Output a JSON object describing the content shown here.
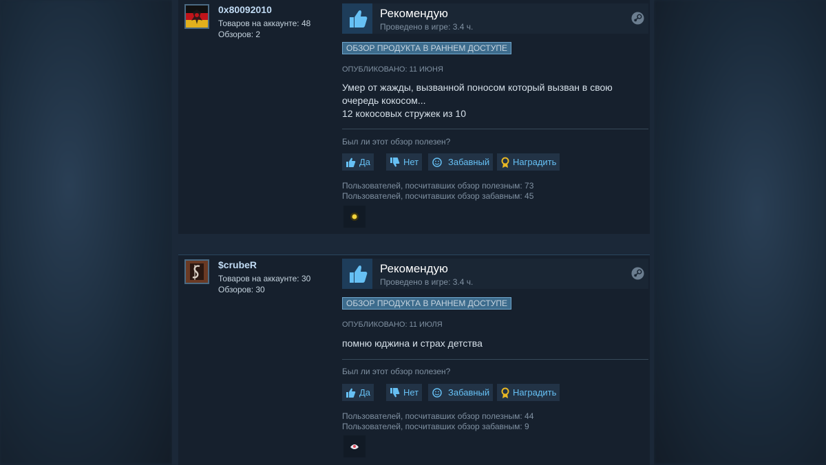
{
  "reviews": [
    {
      "author": {
        "name": "0x80092010",
        "products": "Товаров на аккаунте: 48",
        "reviews": "Обзоров: 2"
      },
      "vote": {
        "title": "Рекомендую",
        "hours": "Проведено в игре: 3.4 ч."
      },
      "badge": "ОБЗОР ПРОДУКТА В РАННЕМ ДОСТУПЕ",
      "posted": "ОПУБЛИКОВАНО: 11 ИЮНЯ",
      "content": [
        "Умер от жажды, вызванной поносом который вызван в свою",
        "очередь кокосом...",
        "12 кокосовых стружек из 10"
      ],
      "helpful_question": "Был ли этот обзор полезен?",
      "buttons": {
        "yes": "Да",
        "no": "Нет",
        "funny": "Забавный",
        "award": "Наградить"
      },
      "stats": {
        "helpful": "Пользователей, посчитавших обзор полезным: 73",
        "funny": "Пользователей, посчитавших обзор забавным: 45"
      }
    },
    {
      "author": {
        "name": "$crubeR",
        "products": "Товаров на аккаунте: 30",
        "reviews": "Обзоров: 30"
      },
      "vote": {
        "title": "Рекомендую",
        "hours": "Проведено в игре: 3.4 ч."
      },
      "badge": "ОБЗОР ПРОДУКТА В РАННЕМ ДОСТУПЕ",
      "posted": "ОПУБЛИКОВАНО: 11 ИЮЛЯ",
      "content": [
        "помню юджина и страх детства"
      ],
      "helpful_question": "Был ли этот обзор полезен?",
      "buttons": {
        "yes": "Да",
        "no": "Нет",
        "funny": "Забавный",
        "award": "Наградить"
      },
      "stats": {
        "helpful": "Пользователей, посчитавших обзор полезным: 44",
        "funny": "Пользователей, посчитавших обзор забавным: 9"
      }
    }
  ],
  "icons": {
    "thumbs_up_large": "thumbs-up-icon",
    "steam": "steam-icon",
    "yes": "thumbs-up-icon",
    "no": "thumbs-down-icon",
    "funny": "smiley-icon",
    "award": "award-ribbon-icon"
  },
  "colors": {
    "accent": "#66c0f4",
    "page_bg": "#1b2838",
    "review_bg": "#16202d",
    "badge_bg": "#3d6c8d"
  }
}
